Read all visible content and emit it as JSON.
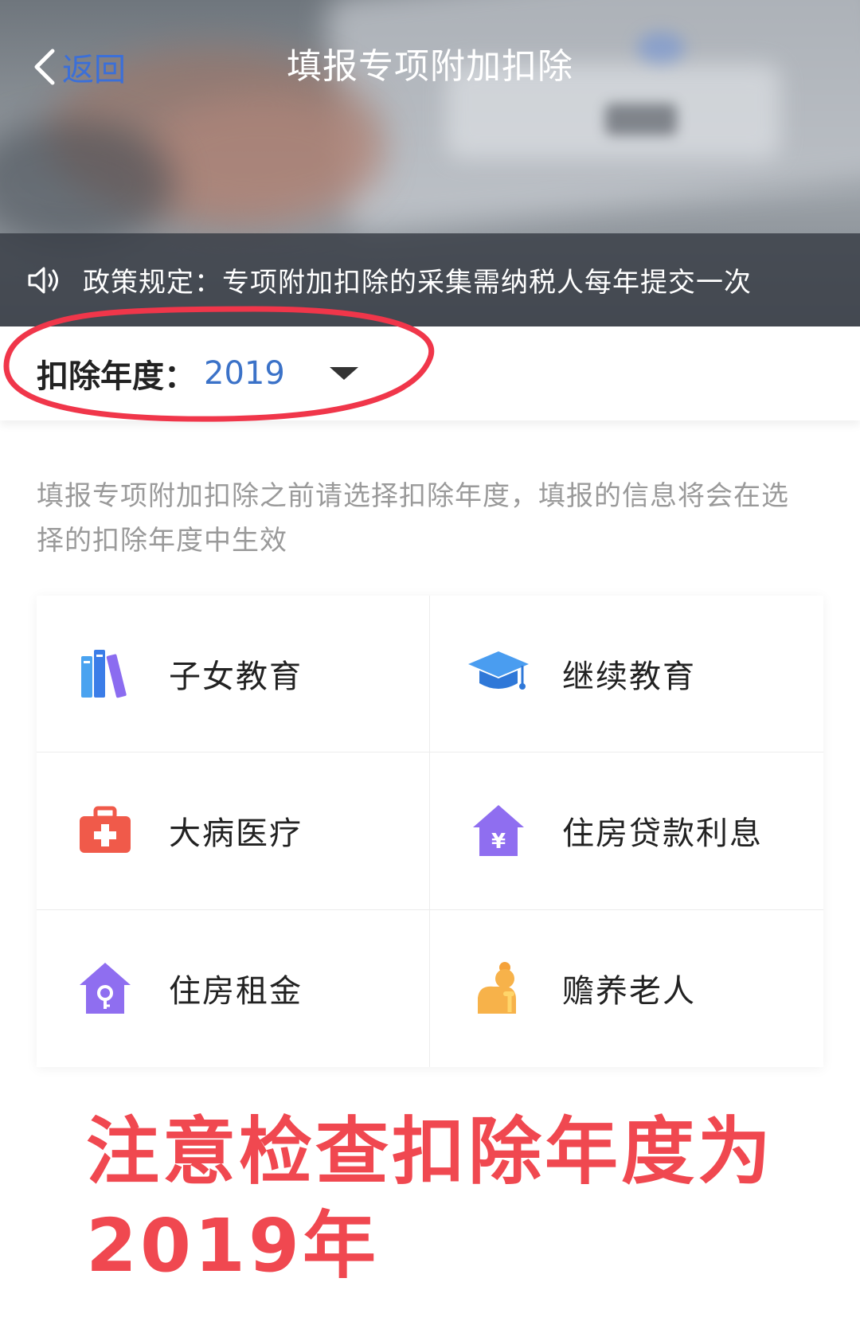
{
  "header": {
    "back_label": "返回",
    "title": "填报专项附加扣除"
  },
  "notice": {
    "icon": "speaker-icon",
    "text": "政策规定：专项附加扣除的采集需纳税人每年提交一次"
  },
  "year_selector": {
    "label": "扣除年度：",
    "value": "2019"
  },
  "hint": "填报专项附加扣除之前请选择扣除年度，填报的信息将会在选择的扣除年度中生效",
  "categories": [
    {
      "label": "子女教育",
      "icon": "books-icon"
    },
    {
      "label": "继续教育",
      "icon": "graduation-cap-icon"
    },
    {
      "label": "大病医疗",
      "icon": "medical-kit-icon"
    },
    {
      "label": "住房贷款利息",
      "icon": "house-yuan-icon"
    },
    {
      "label": "住房租金",
      "icon": "house-key-icon"
    },
    {
      "label": "赡养老人",
      "icon": "elderly-person-icon"
    }
  ],
  "annotation": {
    "line1": "注意检查扣除年度为",
    "line2": "2019年",
    "color": "#f04850"
  },
  "colors": {
    "accent": "#3b72c8",
    "annotation_red": "#f04850"
  }
}
